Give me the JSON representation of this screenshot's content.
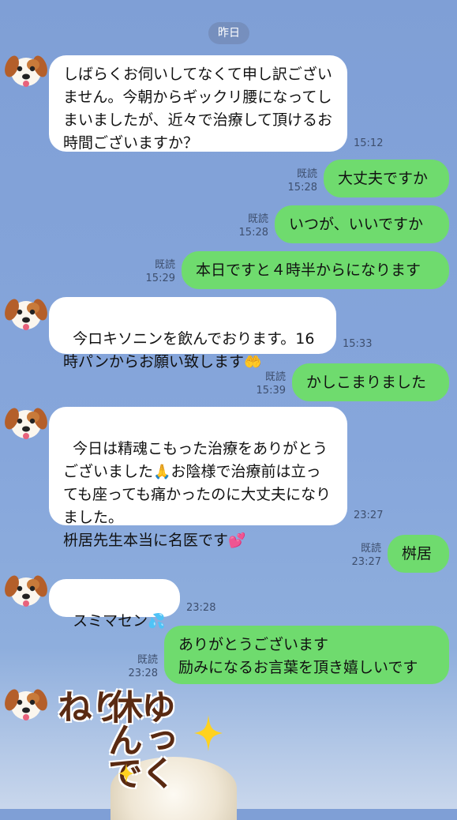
{
  "date_separator": "昨日",
  "messages": [
    {
      "side": "in",
      "text": "しばらくお伺いしてなくて申し訳ございません。今朝からギックリ腰になってしまいましたが、近々で治療して頂けるお時間ございますか？",
      "time": "15:12"
    },
    {
      "side": "out",
      "text": "大丈夫ですか",
      "read": "既読",
      "time": "15:28"
    },
    {
      "side": "out",
      "text": "いつが、いいですか",
      "read": "既読",
      "time": "15:28"
    },
    {
      "side": "out",
      "text": "本日ですと４時半からになります",
      "read": "既読",
      "time": "15:29"
    },
    {
      "side": "in",
      "text": "今ロキソニンを飲んでおります。16時パンからお願い致します",
      "emoji": "open-hands-emoji",
      "time": "15:33"
    },
    {
      "side": "out",
      "text": "かしこまりました",
      "read": "既読",
      "time": "15:39"
    },
    {
      "side": "in",
      "text_a": "今日は精魂こもった治療をありがとうございました",
      "text_b": "お陰様で治療前は立っても座っても痛かったのに大丈夫になりました。",
      "text_c": "枡居先生本当に名医です",
      "emoji_a": "folded-hands-emoji",
      "emoji_c": "two-hearts-emoji",
      "time": "23:27"
    },
    {
      "side": "out",
      "text": "桝居",
      "read": "既読",
      "time": "23:27"
    },
    {
      "side": "in",
      "text": "スミマセン",
      "emoji": "sweat-droplets-emoji",
      "time": "23:28"
    },
    {
      "side": "out",
      "text": "ありがとうございます\n励みになるお言葉を頂き嬉しいです",
      "read": "既読",
      "time": "23:28"
    }
  ],
  "sticker": {
    "line1": "ゆっくり",
    "line2": "休んでね"
  },
  "icons": {
    "avatar": "dog-face-emoji-icon",
    "sparkle": "sparkle-icon"
  },
  "colors": {
    "outgoing": "#6fdb6e",
    "incoming": "#ffffff",
    "background": "#84a4da"
  }
}
